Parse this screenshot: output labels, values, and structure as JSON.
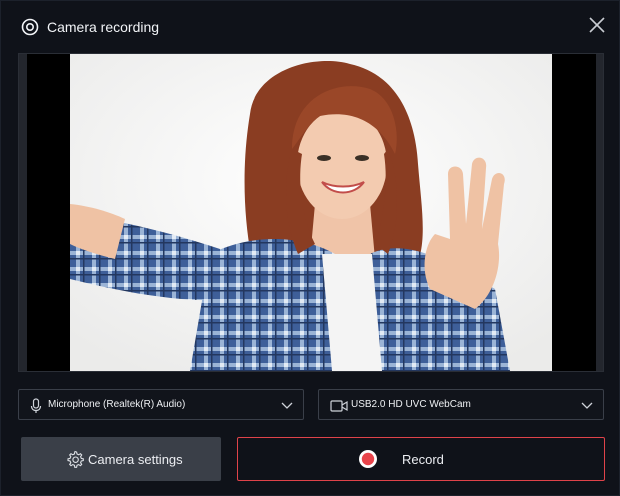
{
  "window": {
    "title": "Camera recording"
  },
  "controls": {
    "microphone": {
      "selected": "Microphone (Realtek(R) Audio)"
    },
    "camera": {
      "selected": "USB2.0 HD UVC WebCam"
    }
  },
  "buttons": {
    "camera_settings": "Camera settings",
    "record": "Record"
  },
  "colors": {
    "background": "#0f1219",
    "record_accent": "#e0434a",
    "settings_button": "#3a3f48"
  },
  "icons": [
    "camera-icon",
    "close-icon",
    "microphone-icon",
    "video-camera-icon",
    "chevron-down-icon",
    "gear-icon",
    "record-dot-icon"
  ]
}
